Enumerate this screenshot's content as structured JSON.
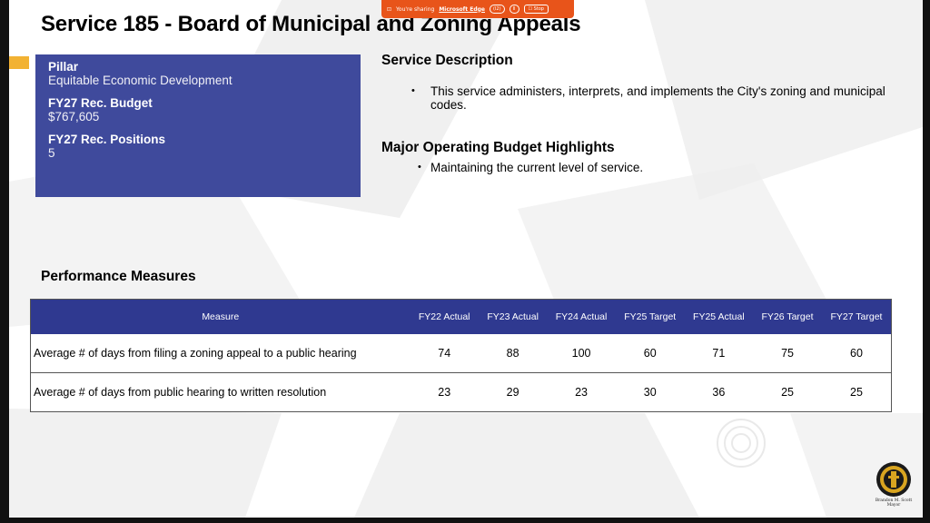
{
  "share_bar": {
    "prefix": "You're sharing",
    "app": "Microsoft Edge",
    "badge": "(I2)",
    "pause": "II",
    "stop": "Stop"
  },
  "slide": {
    "title": "Service 185 - Board of Municipal and Zoning Appeals"
  },
  "info_box": {
    "pillar_label": "Pillar",
    "pillar_value": "Equitable Economic Development",
    "budget_label": "FY27 Rec. Budget",
    "budget_value": "$767,605",
    "positions_label": "FY27 Rec. Positions",
    "positions_value": "5"
  },
  "service_description": {
    "title": "Service Description",
    "bullets": [
      "This service administers, interprets, and implements the City's zoning and municipal codes."
    ]
  },
  "highlights": {
    "title": "Major Operating Budget Highlights",
    "bullets": [
      "Maintaining the current level of service."
    ]
  },
  "performance": {
    "title": "Performance Measures",
    "columns": [
      "Measure",
      "FY22 Actual",
      "FY23 Actual",
      "FY24 Actual",
      "FY25 Target",
      "FY25 Actual",
      "FY26 Target",
      "FY27 Target"
    ],
    "rows": [
      [
        "Average # of days from filing a zoning appeal to a public hearing",
        "74",
        "88",
        "100",
        "60",
        "71",
        "75",
        "60"
      ],
      [
        "Average # of days from public hearing to written resolution",
        "23",
        "29",
        "23",
        "30",
        "36",
        "25",
        "25"
      ]
    ]
  },
  "footer": {
    "mayor_name": "Brandon M. Scott",
    "mayor_title": "Mayor"
  },
  "colors": {
    "accent_blue": "#3f4a9c",
    "table_header": "#2f3990",
    "orange_tab": "#f2b233",
    "share_bar": "#e8541a"
  }
}
